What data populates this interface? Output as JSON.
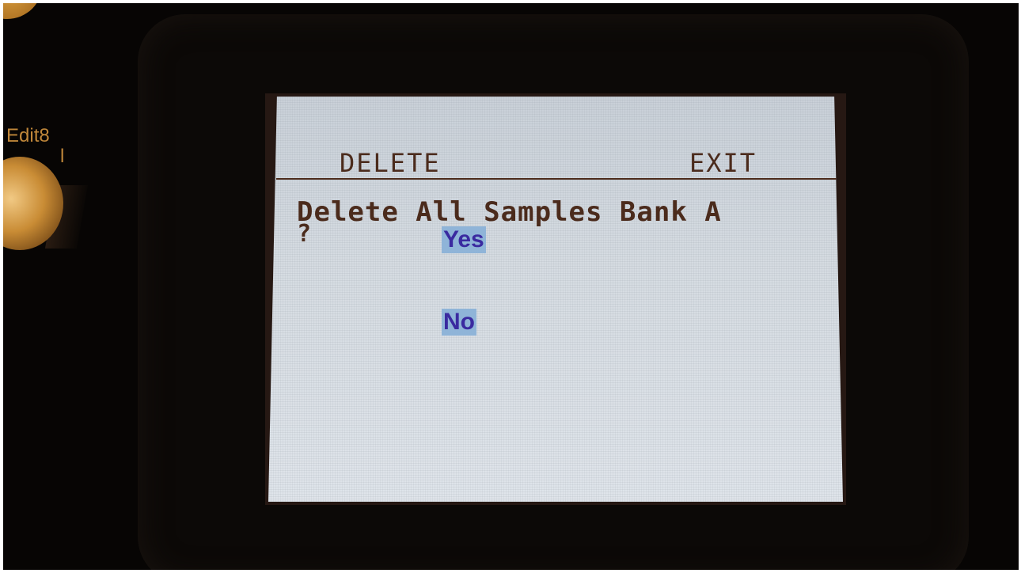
{
  "device": {
    "panel_label": "Edit8",
    "panel_label_partial": "l"
  },
  "screen": {
    "softkeys": {
      "left": "DELETE",
      "right": "EXIT"
    },
    "prompt": "Delete All Samples Bank A",
    "prompt_suffix": "?",
    "options": [
      {
        "label": "Yes"
      },
      {
        "label": "No"
      }
    ]
  }
}
